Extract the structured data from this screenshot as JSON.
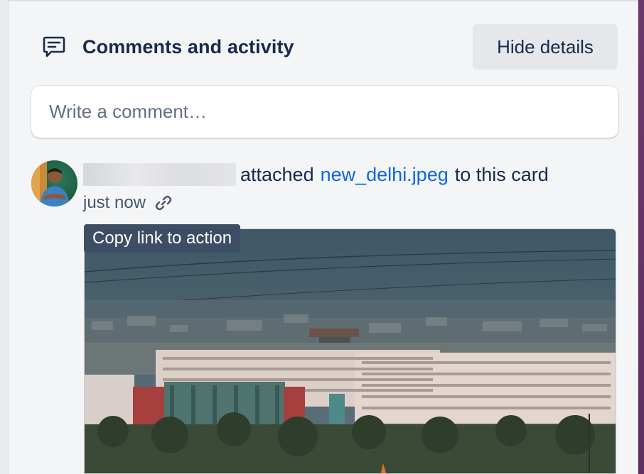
{
  "header": {
    "title": "Comments and activity",
    "hide_button": "Hide details",
    "icon": "comment-icon"
  },
  "comment": {
    "placeholder": "Write a comment…"
  },
  "activity": {
    "verb": "attached",
    "attachment_name": "new_delhi.jpeg",
    "suffix": "to this card",
    "timestamp": "just now",
    "link_icon": "link-icon",
    "tooltip": "Copy link to action"
  },
  "colors": {
    "link": "#0c66e4",
    "tooltip_bg": "#3d4d64",
    "button_bg": "#e5e7eb",
    "panel_bg": "#f4f5f7"
  }
}
